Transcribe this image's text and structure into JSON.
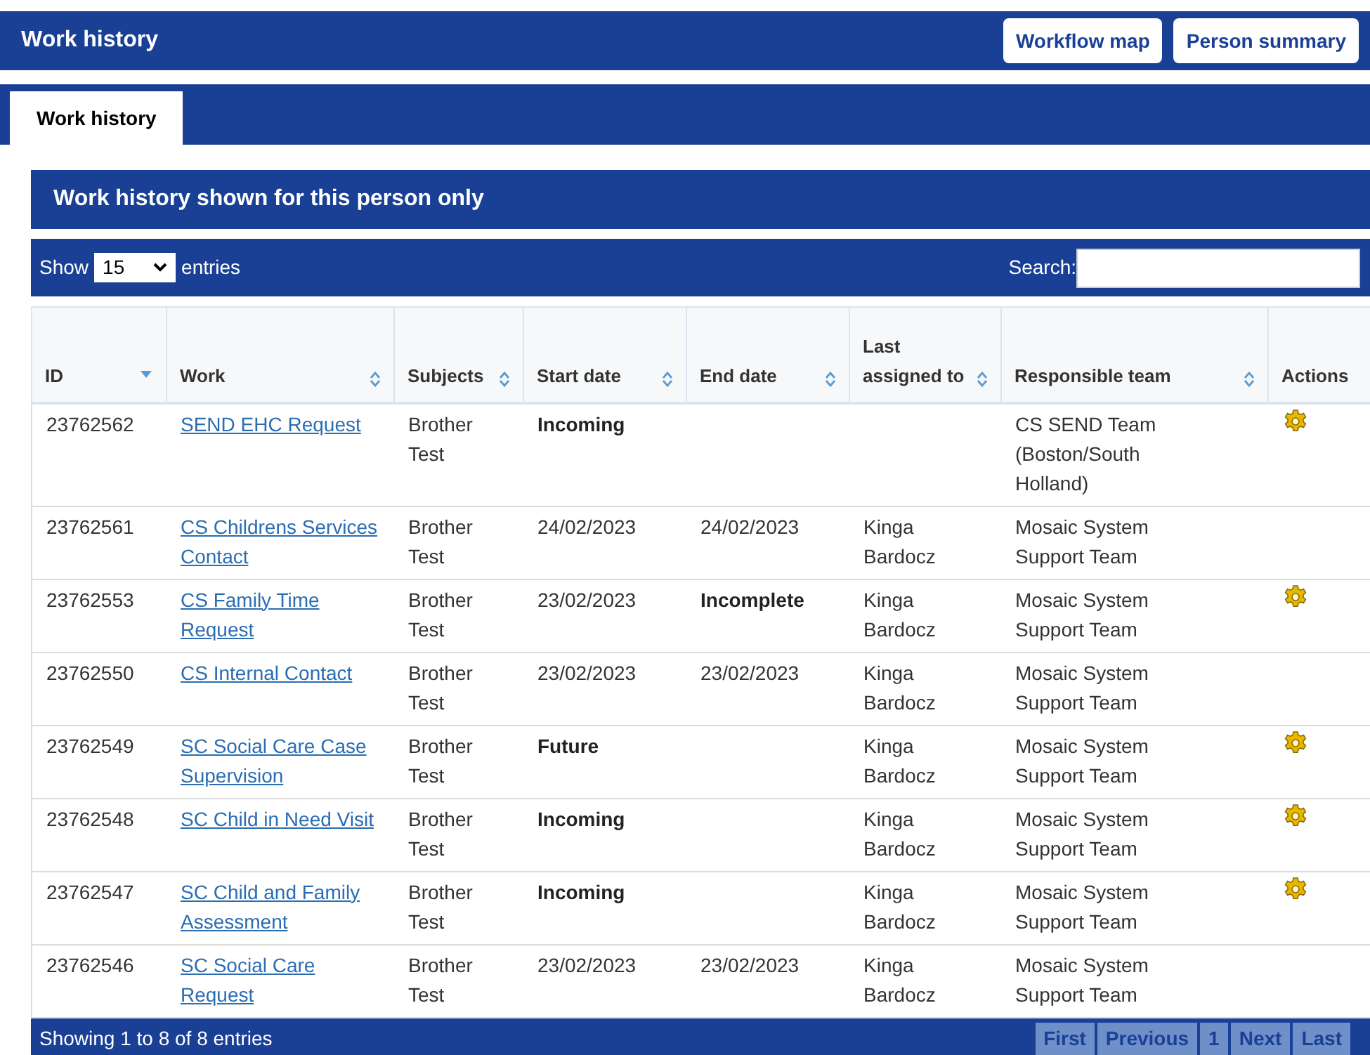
{
  "header": {
    "title": "Work history",
    "buttons": [
      "Workflow map",
      "Person summary"
    ]
  },
  "tabs": [
    {
      "label": "Work history",
      "selected": true
    }
  ],
  "panel": {
    "title": "Work history shown for this person only",
    "length_menu": {
      "before": "Show",
      "value": "15",
      "after": "entries"
    },
    "search": {
      "label": "Search:"
    },
    "columns": [
      {
        "label": "ID",
        "sortable": true,
        "sorted": true
      },
      {
        "label": "Work",
        "sortable": true,
        "sorted": false
      },
      {
        "label": "Subjects",
        "sortable": true,
        "sorted": false
      },
      {
        "label": "Start date",
        "sortable": true,
        "sorted": false
      },
      {
        "label": "End date",
        "sortable": true,
        "sorted": false
      },
      {
        "label": "Last assigned to",
        "sortable": true,
        "sorted": false
      },
      {
        "label": "Responsible team",
        "sortable": true,
        "sorted": false
      },
      {
        "label": "Actions",
        "sortable": false,
        "sorted": false
      }
    ],
    "rows": [
      {
        "id": "23762562",
        "work": "SEND EHC Request",
        "subjects": "Brother Test",
        "start": {
          "text": "Incoming",
          "kind": "status"
        },
        "end": null,
        "assigned": null,
        "team": "CS SEND Team (Boston/South Holland)",
        "has_action": true
      },
      {
        "id": "23762561",
        "work": "CS Childrens Services Contact",
        "subjects": "Brother Test",
        "start": {
          "text": "24/02/2023",
          "kind": "date"
        },
        "end": {
          "text": "24/02/2023",
          "kind": "date"
        },
        "assigned": "Kinga Bardocz",
        "team": "Mosaic System Support Team",
        "has_action": false
      },
      {
        "id": "23762553",
        "work": "CS Family Time Request",
        "subjects": "Brother Test",
        "start": {
          "text": "23/02/2023",
          "kind": "date"
        },
        "end": {
          "text": "Incomplete",
          "kind": "status"
        },
        "assigned": "Kinga Bardocz",
        "team": "Mosaic System Support Team",
        "has_action": true
      },
      {
        "id": "23762550",
        "work": "CS Internal Contact",
        "subjects": "Brother Test",
        "start": {
          "text": "23/02/2023",
          "kind": "date"
        },
        "end": {
          "text": "23/02/2023",
          "kind": "date"
        },
        "assigned": "Kinga Bardocz",
        "team": "Mosaic System Support Team",
        "has_action": false
      },
      {
        "id": "23762549",
        "work": "SC Social Care Case Supervision",
        "subjects": "Brother Test",
        "start": {
          "text": "Future",
          "kind": "status"
        },
        "end": null,
        "assigned": "Kinga Bardocz",
        "team": "Mosaic System Support Team",
        "has_action": true
      },
      {
        "id": "23762548",
        "work": "SC Child in Need Visit",
        "subjects": "Brother Test",
        "start": {
          "text": "Incoming",
          "kind": "status"
        },
        "end": null,
        "assigned": "Kinga Bardocz",
        "team": "Mosaic System Support Team",
        "has_action": true
      },
      {
        "id": "23762547",
        "work": "SC Child and Family Assessment",
        "subjects": "Brother Test",
        "start": {
          "text": "Incoming",
          "kind": "status"
        },
        "end": null,
        "assigned": "Kinga Bardocz",
        "team": "Mosaic System Support Team",
        "has_action": true
      },
      {
        "id": "23762546",
        "work": "SC Social Care Request",
        "subjects": "Brother Test",
        "start": {
          "text": "23/02/2023",
          "kind": "date"
        },
        "end": {
          "text": "23/02/2023",
          "kind": "date"
        },
        "assigned": "Kinga Bardocz",
        "team": "Mosaic System Support Team",
        "has_action": false
      }
    ],
    "info": "Showing 1 to 8 of 8 entries",
    "pagination": [
      {
        "label": "First",
        "disabled": true
      },
      {
        "label": "Previous",
        "disabled": true
      },
      {
        "label": "1",
        "disabled": true
      },
      {
        "label": "Next",
        "disabled": true
      },
      {
        "label": "Last",
        "disabled": true
      }
    ]
  }
}
